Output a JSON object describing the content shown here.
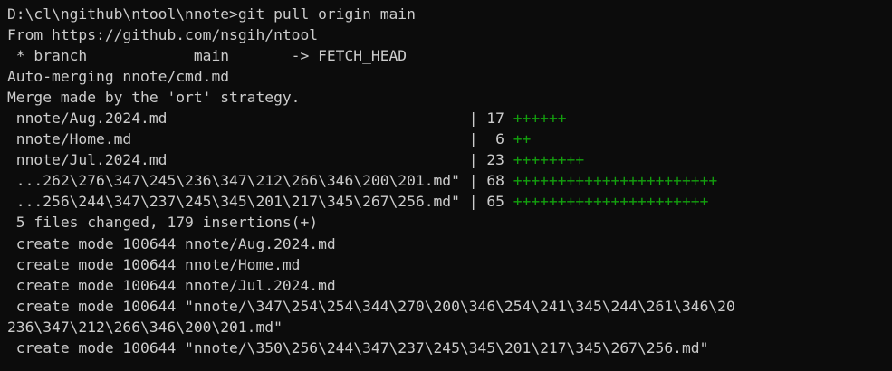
{
  "colors": {
    "background": "#0c0c0c",
    "text": "#cccccc",
    "insertions": "#13a10e"
  },
  "terminal": {
    "lines": [
      {
        "text": "D:\\cl\\ngithub\\ntool\\nnote>git pull origin main",
        "plus": ""
      },
      {
        "text": "From https://github.com/nsgih/ntool",
        "plus": ""
      },
      {
        "text": " * branch            main       -> FETCH_HEAD",
        "plus": ""
      },
      {
        "text": "Auto-merging nnote/cmd.md",
        "plus": ""
      },
      {
        "text": "Merge made by the 'ort' strategy.",
        "plus": ""
      },
      {
        "text": " nnote/Aug.2024.md                                  | 17 ",
        "plus": "++++++"
      },
      {
        "text": " nnote/Home.md                                      |  6 ",
        "plus": "++"
      },
      {
        "text": " nnote/Jul.2024.md                                  | 23 ",
        "plus": "++++++++"
      },
      {
        "text": " ...262\\276\\347\\245\\236\\347\\212\\266\\346\\200\\201.md\" | 68 ",
        "plus": "+++++++++++++++++++++++"
      },
      {
        "text": " ...256\\244\\347\\237\\245\\345\\201\\217\\345\\267\\256.md\" | 65 ",
        "plus": "++++++++++++++++++++++"
      },
      {
        "text": " 5 files changed, 179 insertions(+)",
        "plus": ""
      },
      {
        "text": " create mode 100644 nnote/Aug.2024.md",
        "plus": ""
      },
      {
        "text": " create mode 100644 nnote/Home.md",
        "plus": ""
      },
      {
        "text": " create mode 100644 nnote/Jul.2024.md",
        "plus": ""
      },
      {
        "text": " create mode 100644 \"nnote/\\347\\254\\254\\344\\270\\200\\346\\254\\241\\345\\244\\261\\346\\20",
        "plus": ""
      },
      {
        "text": "236\\347\\212\\266\\346\\200\\201.md\"",
        "plus": ""
      },
      {
        "text": " create mode 100644 \"nnote/\\350\\256\\244\\347\\237\\245\\345\\201\\217\\345\\267\\256.md\"",
        "plus": ""
      }
    ]
  }
}
